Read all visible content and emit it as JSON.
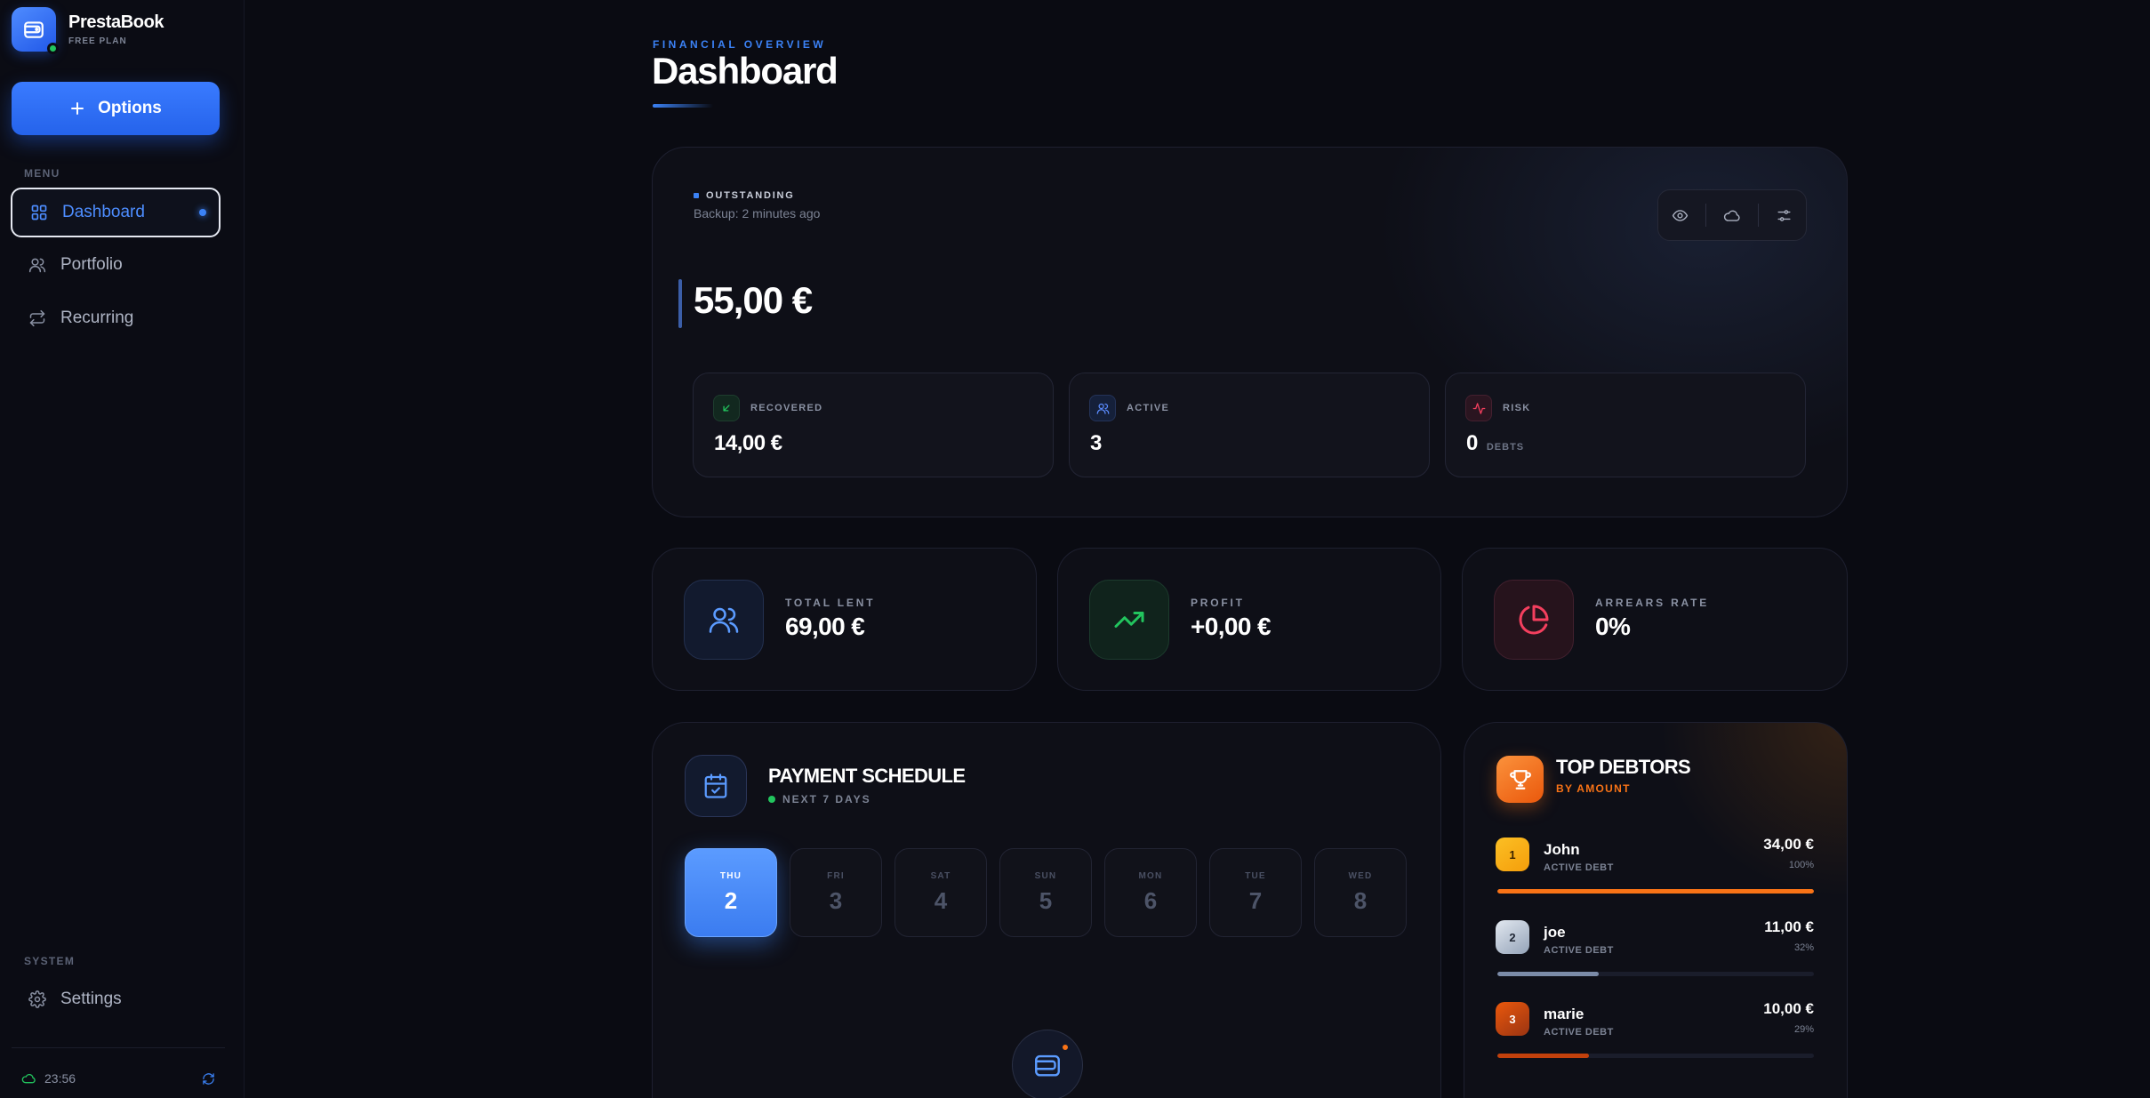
{
  "brand": {
    "name": "PrestaBook",
    "plan": "FREE PLAN"
  },
  "sidebar": {
    "options_label": "Options",
    "menu_label": "MENU",
    "items": [
      {
        "label": "Dashboard",
        "icon": "grid-icon",
        "active": true
      },
      {
        "label": "Portfolio",
        "icon": "users-icon",
        "active": false
      },
      {
        "label": "Recurring",
        "icon": "repeat-icon",
        "active": false
      }
    ],
    "system_label": "SYSTEM",
    "settings_label": "Settings",
    "sync_time": "23:56"
  },
  "header": {
    "eyebrow": "FINANCIAL OVERVIEW",
    "title": "Dashboard"
  },
  "outstanding": {
    "label": "OUTSTANDING",
    "backup": "Backup: 2 minutes ago",
    "amount": "55,00 €",
    "tools": [
      "eye-icon",
      "cloud-icon",
      "sliders-icon"
    ],
    "recovered": {
      "label": "RECOVERED",
      "value": "14,00 €"
    },
    "active": {
      "label": "ACTIVE",
      "value": "3"
    },
    "risk": {
      "label": "RISK",
      "value": "0",
      "unit": "DEBTS"
    }
  },
  "stats": [
    {
      "label": "TOTAL LENT",
      "value": "69,00 €",
      "icon": "users-icon"
    },
    {
      "label": "PROFIT",
      "value": "+0,00 €",
      "icon": "trending-up-icon"
    },
    {
      "label": "ARREARS RATE",
      "value": "0%",
      "icon": "pie-chart-icon"
    }
  ],
  "schedule": {
    "title": "PAYMENT SCHEDULE",
    "subtitle": "NEXT 7 DAYS",
    "days": [
      {
        "name": "THU",
        "num": "2"
      },
      {
        "name": "FRI",
        "num": "3"
      },
      {
        "name": "SAT",
        "num": "4"
      },
      {
        "name": "SUN",
        "num": "5"
      },
      {
        "name": "MON",
        "num": "6"
      },
      {
        "name": "TUE",
        "num": "7"
      },
      {
        "name": "WED",
        "num": "8"
      }
    ]
  },
  "debtors": {
    "title": "TOP DEBTORS",
    "subtitle": "BY AMOUNT",
    "list": [
      {
        "rank": "1",
        "name": "John",
        "status": "ACTIVE DEBT",
        "amount": "34,00 €",
        "percent": "100%",
        "share": 1.0,
        "color": "#f97316"
      },
      {
        "rank": "2",
        "name": "joe",
        "status": "ACTIVE DEBT",
        "amount": "11,00 €",
        "percent": "32%",
        "share": 0.32,
        "color": "#7b8ba8"
      },
      {
        "rank": "3",
        "name": "marie",
        "status": "ACTIVE DEBT",
        "amount": "10,00 €",
        "percent": "29%",
        "share": 0.29,
        "color": "#c2410c"
      }
    ]
  },
  "colors": {
    "accent": "#3b82f6",
    "success": "#22c55e",
    "warning": "#f97316",
    "danger": "#f43f5e"
  }
}
